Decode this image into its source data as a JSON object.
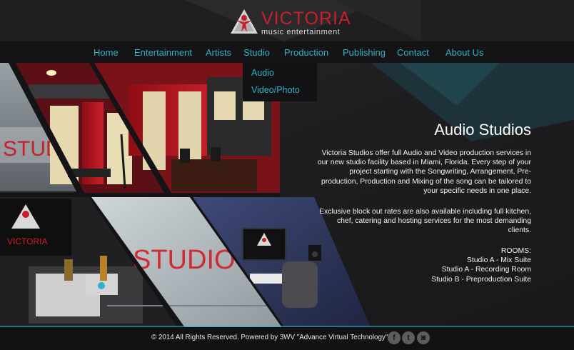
{
  "brand": {
    "name": "VICTORIA",
    "tagline": "music entertainment",
    "color": "#c8202a"
  },
  "nav": {
    "accent": "#2fb2c8",
    "items": [
      {
        "label": "Home"
      },
      {
        "label": "Entertainment"
      },
      {
        "label": "Artists"
      },
      {
        "label": "Studio"
      },
      {
        "label": "Production"
      },
      {
        "label": "Publishing"
      },
      {
        "label": "Contact"
      },
      {
        "label": "About Us"
      }
    ],
    "dropdown": [
      {
        "label": "Audio"
      },
      {
        "label": "Video/Photo"
      }
    ]
  },
  "photos": {
    "studio_sign": "STUDIO",
    "studio_sign_partial": "STUDIO",
    "logo_small": "VICTORIA"
  },
  "content": {
    "title": "Audio Studios",
    "paragraph1": "Victoria Studios offer full Audio and Video production services in our new studio facility based in Miami, Florida. Every step of your project starting with the Songwriting, Arrangement, Pre-production, Production and Mixing of the song can be tailored to your specific needs in one place.",
    "paragraph2": "Exclusive block out rates are also available including full kitchen, chef, catering and hosting services for the most demanding clients.",
    "rooms_heading": "ROOMS:",
    "rooms": [
      "Studio A - Mix Suite",
      "Studio A - Recording Room",
      "Studio B - Preproduction Suite"
    ]
  },
  "footer": {
    "copyright": "© 2014 All Rights Reserved. Powered by 3WV \"Advance Virtual Technology\"",
    "social": [
      {
        "icon": "facebook-icon",
        "glyph": "f"
      },
      {
        "icon": "twitter-icon",
        "glyph": "t"
      },
      {
        "icon": "instagram-icon",
        "glyph": "◙"
      }
    ]
  }
}
